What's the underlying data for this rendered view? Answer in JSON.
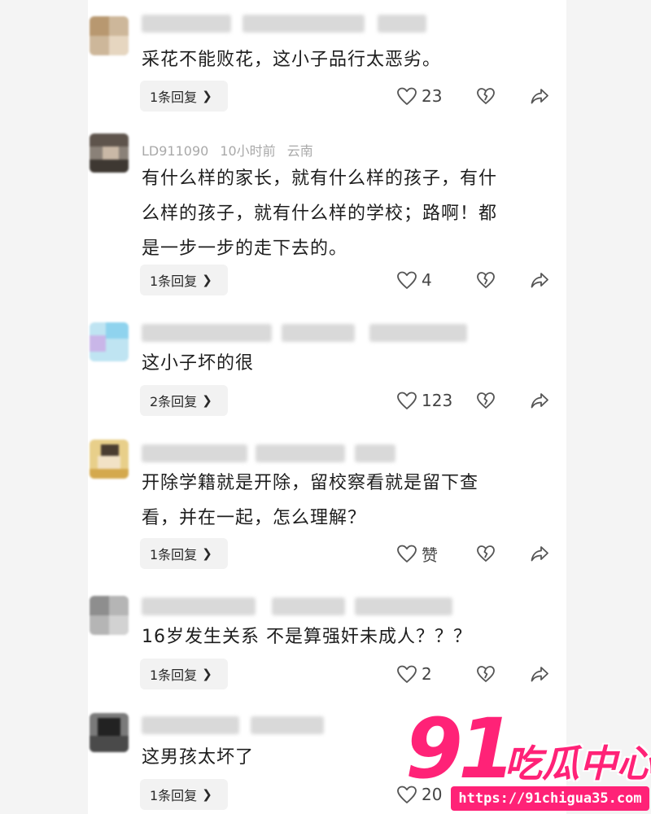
{
  "comments": [
    {
      "username": "",
      "time": "",
      "location": "",
      "text": "采花不能败花，这小子品行太恶劣。",
      "reply_label": "1条回复",
      "likes": "23"
    },
    {
      "username": "LD911090",
      "time": "10小时前",
      "location": "云南",
      "text": "有什么样的家长，就有什么样的孩子，有什\n么样的孩子，就有什么样的学校；路啊！都\n是一步一步的走下去的。",
      "reply_label": "1条回复",
      "likes": "4"
    },
    {
      "username": "",
      "time": "",
      "location": "",
      "text": "这小子坏的很",
      "reply_label": "2条回复",
      "likes": "123"
    },
    {
      "username": "",
      "time": "",
      "location": "",
      "text": "开除学籍就是开除，留校察看就是留下查\n看，并在一起，怎么理解？",
      "reply_label": "1条回复",
      "likes": "赞"
    },
    {
      "username": "",
      "time": "",
      "location": "",
      "text": "16岁发生关系 不是算强奸未成人？？？",
      "reply_label": "1条回复",
      "likes": "2"
    },
    {
      "username": "",
      "time": "",
      "location": "",
      "text": "这男孩太坏了",
      "reply_label": "1条回复",
      "likes": "20"
    }
  ],
  "icons": {
    "like": "heart-outline-icon",
    "dislike": "broken-heart-icon",
    "share": "share-arrow-icon",
    "reply": "chevron-right-icon"
  },
  "watermark": {
    "number": "91",
    "brand": "吃瓜中心",
    "url": "https://91chigua35.com"
  },
  "colors": {
    "text": "#1e1e1e",
    "meta": "#a9a9a9",
    "reply_bg": "#f2f2f2",
    "watermark": "#ff2277"
  }
}
